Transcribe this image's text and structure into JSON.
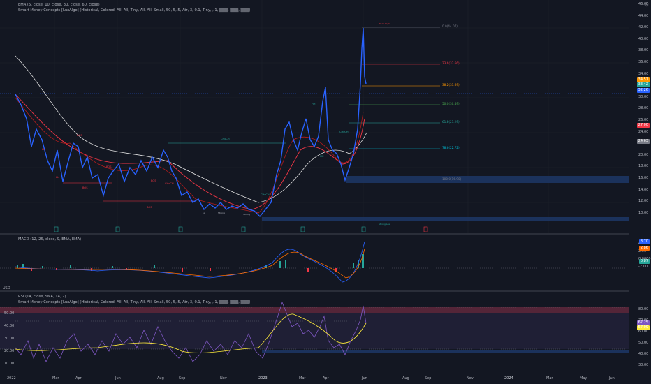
{
  "legends": {
    "ema": "EMA (5, close, 10, close, 30, close, 60, close)",
    "smc": "Smart Money Concepts [LuxAlgo] (Historical, Colored, All, All, Tiny, All, All, Small, 50, 5, 5, Atr, 3, 0.1, Tiny, , 1, ▒▒▒, ▒▒▒, ▒▒▒)",
    "macd": "MACD (12, 26, close, 9, EMA, EMA)",
    "rsi": "RSI (14, close, SMA, 14, 2)",
    "smc2": "Smart Money Concepts [LuxAlgo] (Historical, Colored, All, All, Tiny, All, All, Small, 50, 5, 5, Atr, 3, 0.1, Tiny, , 1, ▒▒▒, ▒▒▒, ▒▒▒)"
  },
  "currency": "USD",
  "price_axis": [
    "46.00",
    "44.00",
    "42.00",
    "40.00",
    "38.00",
    "36.00",
    "34.00",
    "32.00",
    "30.00",
    "28.00",
    "26.00",
    "24.00",
    "22.00",
    "20.00",
    "18.00",
    "16.00",
    "14.00",
    "12.00",
    "10.00"
  ],
  "price_badges": [
    {
      "label": "34.51",
      "color": "#ff9800"
    },
    {
      "label": "33.42",
      "color": "#26a69a"
    },
    {
      "label": "32.26",
      "color": "#2962ff"
    },
    {
      "label": "27.00",
      "color": "#f23645"
    },
    {
      "label": "24.63",
      "color": "#787b86"
    }
  ],
  "macd_axis": [
    "4.00",
    "2.00",
    "0.0000",
    "-2.00"
  ],
  "macd_badges": [
    {
      "label": "3.70",
      "color": "#2962ff"
    },
    {
      "label": "2.86",
      "color": "#ff6d00"
    },
    {
      "label": "0.87",
      "color": "#26a69a"
    }
  ],
  "rsi_axis": [
    "80.00",
    "70.00",
    "60.00",
    "50.00",
    "40.00",
    "30.00"
  ],
  "rsi_left_axis": [
    "50.00",
    "40.00",
    "30.00",
    "20.00",
    "10.00"
  ],
  "rsi_badges": [
    {
      "label": "67.25",
      "color": "#7e57c2"
    },
    {
      "label": "57.09",
      "color": "#ffeb3b"
    }
  ],
  "fib_levels": [
    {
      "label": "0.0(44.07)",
      "color": "#787b86"
    },
    {
      "label": "23.6(37.66)",
      "color": "#f23645"
    },
    {
      "label": "38.2(33.69)",
      "color": "#ff9800"
    },
    {
      "label": "50.0(30.49)",
      "color": "#4caf50"
    },
    {
      "label": "61.8(27.29)",
      "color": "#26a69a"
    },
    {
      "label": "78.6(22.72)",
      "color": "#00bcd4"
    },
    {
      "label": "100.0(16.90)",
      "color": "#787b86"
    }
  ],
  "x_axis": [
    "2022",
    "Mar",
    "Apr",
    "Jun",
    "Aug",
    "Sep",
    "Nov",
    "2023",
    "Mar",
    "Apr",
    "Jun",
    "Aug",
    "Sep",
    "Nov",
    "2024",
    "Mar",
    "May",
    "Jun"
  ],
  "smc_labels": {
    "choch": "CHoCH",
    "bos": "BOS",
    "strong_high": "Strong High",
    "weak_high": "Weak High",
    "strong_low": "Strong Low",
    "hh": "HH",
    "ll": "LL"
  }
}
